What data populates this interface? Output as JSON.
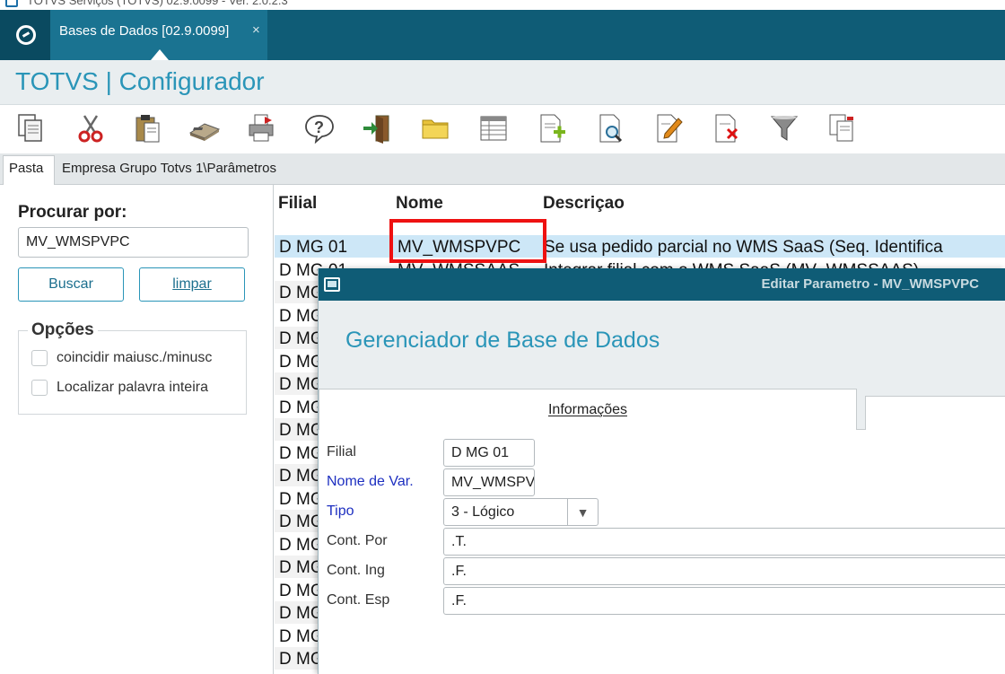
{
  "window": {
    "title": "TOTVS Serviços (TOTVS) 02.9.0099 - Ver. 2.0.2.3"
  },
  "tabbar": {
    "tab_label": "Bases de Dados [02.9.0099]",
    "close_glyph": "×"
  },
  "app": {
    "title": "TOTVS | Configurador"
  },
  "toolbar": {
    "items": [
      "copy-icon",
      "cut-icon",
      "paste-icon",
      "calculator-icon",
      "printer-icon",
      "help-icon",
      "exit-icon",
      "folder-icon",
      "table-icon",
      "add-document-icon",
      "search-document-icon",
      "edit-document-icon",
      "delete-document-icon",
      "filter-icon",
      "document-copy-icon"
    ]
  },
  "breadcrumb": {
    "pasta_tab": "Pasta",
    "path": "Empresa Grupo Totvs 1\\Parâmetros"
  },
  "search": {
    "label": "Procurar por:",
    "value": "MV_WMSPVPC",
    "buscar_button": "Buscar",
    "limpar_button": "limpar",
    "options_title": "Opções",
    "option1": "coincidir maiusc./minusc",
    "option2": "Localizar palavra inteira"
  },
  "grid": {
    "headers": {
      "filial": "Filial",
      "nome": "Nome",
      "descricao": "Descriçao"
    },
    "selected_row": {
      "filial": "D MG 01",
      "nome": "MV_WMSPVPC",
      "descricao": "Se usa pedido parcial no WMS SaaS (Seq. Identifica"
    },
    "second_row": {
      "filial": "D MG 01",
      "nome": "MV_WMSSAAS",
      "descricao": "Integrar filial com o WMS SaaS (MV_WMSSAAS)"
    },
    "partial_rows": [
      "D MG",
      "D MG",
      "D MG",
      "D MG",
      "D MG",
      "D MG",
      "D MG",
      "D MG",
      "D MG",
      "D MG",
      "D MG",
      "D MG",
      "D MG",
      "D MG",
      "D MG",
      "D MG",
      "D MG",
      "D MG"
    ]
  },
  "dialog": {
    "title": "Editar Parametro - MV_WMSPVPC",
    "header": "Gerenciador de Base de Dados",
    "tab_info": "Informações",
    "fields": {
      "filial_label": "Filial",
      "filial_value": "D MG 01",
      "nome_label": "Nome de Var.",
      "nome_value": "MV_WMSPVPC",
      "tipo_label": "Tipo",
      "tipo_value": "3 - Lógico",
      "por_label": "Cont. Por",
      "por_value": ".T.",
      "ing_label": "Cont. Ing",
      "ing_value": ".F.",
      "esp_label": "Cont. Esp",
      "esp_value": ".F."
    }
  }
}
